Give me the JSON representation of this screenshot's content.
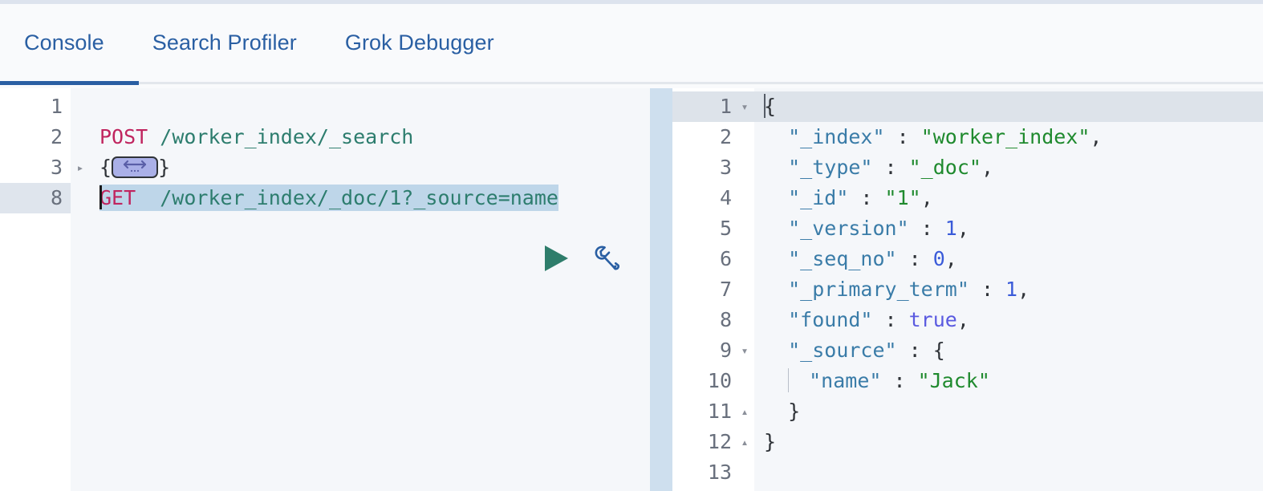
{
  "window": {
    "title": "Console"
  },
  "tabs": [
    {
      "label": "Console",
      "name": "tab-console",
      "active": true
    },
    {
      "label": "Search Profiler",
      "name": "tab-search-profiler",
      "active": false
    },
    {
      "label": "Grok Debugger",
      "name": "tab-grok-debugger",
      "active": false
    }
  ],
  "colors": {
    "accent_blue": "#2a5fa3",
    "tab_underline": "#2a5fa3",
    "method": "#c0255f",
    "url": "#2d7d6e",
    "json_key": "#3a7ca8",
    "json_string": "#1f8a2e",
    "json_number": "#3a5bd9",
    "json_boolean": "#5a5ae0",
    "selection": "#bed6e9",
    "active_line": "#dde3ea",
    "editor_bg": "#f5f7fa",
    "divider": "#cedfee",
    "play_icon": "#2e7d6b",
    "wrench_icon": "#2a5fa3",
    "fold_widget_fill": "#aab0e8"
  },
  "request_editor": {
    "name": "console-request-editor",
    "lines": [
      {
        "number": "1",
        "fold": "",
        "active": false,
        "tokens": []
      },
      {
        "number": "2",
        "fold": "",
        "active": false,
        "tokens": [
          {
            "text": "POST",
            "cls": "k-method"
          },
          {
            "text": " /worker_index/_search",
            "cls": "k-url"
          }
        ]
      },
      {
        "number": "3",
        "fold": "collapsed",
        "active": false,
        "tokens": [
          {
            "text": "{",
            "cls": "k-punc"
          },
          {
            "text": "FOLD_WIDGET",
            "cls": "widget"
          },
          {
            "text": "}",
            "cls": "k-punc"
          }
        ]
      },
      {
        "number": "8",
        "fold": "",
        "active": true,
        "selected": true,
        "tokens": [
          {
            "text": "GET",
            "cls": "k-method"
          },
          {
            "text": "  /worker_index/_doc/1?_source=name",
            "cls": "k-url"
          }
        ]
      }
    ]
  },
  "actions": {
    "play": {
      "name": "send-request-play-button",
      "label": "▶"
    },
    "wrench": {
      "name": "request-options-wrench-button",
      "label": "wrench"
    }
  },
  "response_editor": {
    "name": "console-response-editor",
    "lines": [
      {
        "number": "1",
        "fold": "open",
        "active": true,
        "tokens": [
          {
            "text": "CURSOR",
            "cls": "cursor"
          },
          {
            "text": "{",
            "cls": "k-punc"
          }
        ]
      },
      {
        "number": "2",
        "fold": "",
        "active": false,
        "tokens": [
          {
            "text": "  ",
            "cls": "k-plain"
          },
          {
            "text": "\"_index\"",
            "cls": "k-key"
          },
          {
            "text": " : ",
            "cls": "k-punc"
          },
          {
            "text": "\"worker_index\"",
            "cls": "k-str"
          },
          {
            "text": ",",
            "cls": "k-punc"
          }
        ]
      },
      {
        "number": "3",
        "fold": "",
        "active": false,
        "tokens": [
          {
            "text": "  ",
            "cls": "k-plain"
          },
          {
            "text": "\"_type\"",
            "cls": "k-key"
          },
          {
            "text": " : ",
            "cls": "k-punc"
          },
          {
            "text": "\"_doc\"",
            "cls": "k-str"
          },
          {
            "text": ",",
            "cls": "k-punc"
          }
        ]
      },
      {
        "number": "4",
        "fold": "",
        "active": false,
        "tokens": [
          {
            "text": "  ",
            "cls": "k-plain"
          },
          {
            "text": "\"_id\"",
            "cls": "k-key"
          },
          {
            "text": " : ",
            "cls": "k-punc"
          },
          {
            "text": "\"1\"",
            "cls": "k-str"
          },
          {
            "text": ",",
            "cls": "k-punc"
          }
        ]
      },
      {
        "number": "5",
        "fold": "",
        "active": false,
        "tokens": [
          {
            "text": "  ",
            "cls": "k-plain"
          },
          {
            "text": "\"_version\"",
            "cls": "k-key"
          },
          {
            "text": " : ",
            "cls": "k-punc"
          },
          {
            "text": "1",
            "cls": "k-num"
          },
          {
            "text": ",",
            "cls": "k-punc"
          }
        ]
      },
      {
        "number": "6",
        "fold": "",
        "active": false,
        "tokens": [
          {
            "text": "  ",
            "cls": "k-plain"
          },
          {
            "text": "\"_seq_no\"",
            "cls": "k-key"
          },
          {
            "text": " : ",
            "cls": "k-punc"
          },
          {
            "text": "0",
            "cls": "k-num"
          },
          {
            "text": ",",
            "cls": "k-punc"
          }
        ]
      },
      {
        "number": "7",
        "fold": "",
        "active": false,
        "tokens": [
          {
            "text": "  ",
            "cls": "k-plain"
          },
          {
            "text": "\"_primary_term\"",
            "cls": "k-key"
          },
          {
            "text": " : ",
            "cls": "k-punc"
          },
          {
            "text": "1",
            "cls": "k-num"
          },
          {
            "text": ",",
            "cls": "k-punc"
          }
        ]
      },
      {
        "number": "8",
        "fold": "",
        "active": false,
        "tokens": [
          {
            "text": "  ",
            "cls": "k-plain"
          },
          {
            "text": "\"found\"",
            "cls": "k-key"
          },
          {
            "text": " : ",
            "cls": "k-punc"
          },
          {
            "text": "true",
            "cls": "k-bool"
          },
          {
            "text": ",",
            "cls": "k-punc"
          }
        ]
      },
      {
        "number": "9",
        "fold": "open",
        "active": false,
        "tokens": [
          {
            "text": "  ",
            "cls": "k-plain"
          },
          {
            "text": "\"_source\"",
            "cls": "k-key"
          },
          {
            "text": " : ",
            "cls": "k-punc"
          },
          {
            "text": "{",
            "cls": "k-punc"
          }
        ]
      },
      {
        "number": "10",
        "fold": "",
        "active": false,
        "tokens": [
          {
            "text": "INDENT_GUIDE",
            "cls": "guide"
          },
          {
            "text": "\"name\"",
            "cls": "k-key"
          },
          {
            "text": " : ",
            "cls": "k-punc"
          },
          {
            "text": "\"Jack\"",
            "cls": "k-str"
          }
        ]
      },
      {
        "number": "11",
        "fold": "close",
        "active": false,
        "tokens": [
          {
            "text": "  }",
            "cls": "k-punc"
          }
        ]
      },
      {
        "number": "12",
        "fold": "close",
        "active": false,
        "tokens": [
          {
            "text": "}",
            "cls": "k-punc"
          }
        ]
      },
      {
        "number": "13",
        "fold": "",
        "active": false,
        "tokens": []
      }
    ]
  },
  "response_json": {
    "_index": "worker_index",
    "_type": "_doc",
    "_id": "1",
    "_version": 1,
    "_seq_no": 0,
    "_primary_term": 1,
    "found": true,
    "_source": {
      "name": "Jack"
    }
  }
}
